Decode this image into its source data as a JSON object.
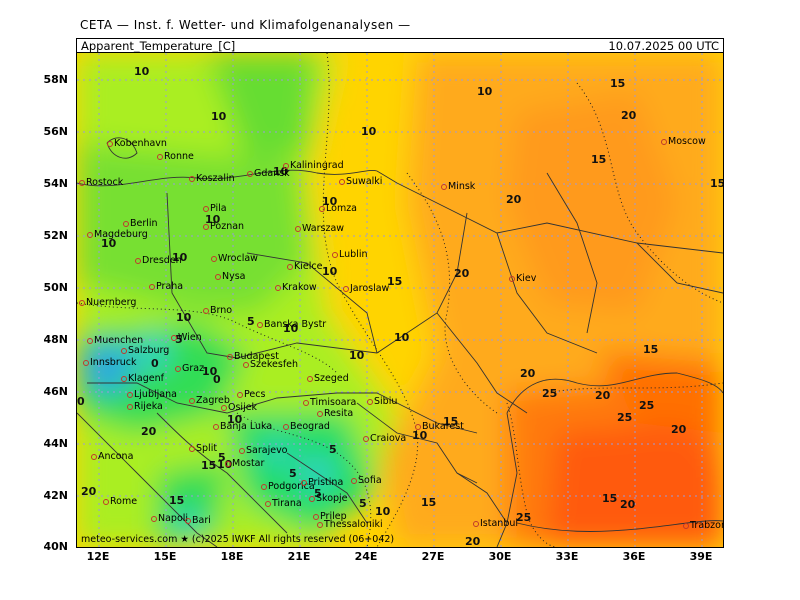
{
  "header": {
    "source": "CETA — Inst. f. Wetter- und Klimafolgenanalysen —",
    "parameter": "Apparent_Temperature_[C]",
    "valid_time": "10.07.2025 00 UTC"
  },
  "axes": {
    "lat_labels": [
      "58N",
      "56N",
      "54N",
      "52N",
      "50N",
      "48N",
      "46N",
      "44N",
      "42N",
      "40N"
    ],
    "lon_labels": [
      "12E",
      "15E",
      "18E",
      "21E",
      "24E",
      "27E",
      "30E",
      "33E",
      "36E",
      "39E"
    ]
  },
  "cities": [
    "Kobenhavn",
    "Ronne",
    "Rostock",
    "Koszalin",
    "Gdansk",
    "Kaliningrad",
    "Suwalki",
    "Minsk",
    "Moscow",
    "Pila",
    "Poznan",
    "Lomza",
    "Berlin",
    "Magdeburg",
    "Warszaw",
    "Lublin",
    "Dresden",
    "Wroclaw",
    "Kielce",
    "Nysa",
    "Praha",
    "Krakow",
    "Jaroslaw",
    "Kiev",
    "Nuernberg",
    "Brno",
    "Banska Bystr",
    "Muenchen",
    "Salzburg",
    "Wien",
    "Innsbruck",
    "Budapest",
    "Szekesfeh",
    "Graz",
    "Klagenf",
    "Szeged",
    "Ljubljana",
    "Rijeka",
    "Pecs",
    "Osijek",
    "Timisoara",
    "Sibiu",
    "Zagreb",
    "Resita",
    "Banja Luka",
    "Beograd",
    "Bukarest",
    "Craiova",
    "Ancona",
    "Split",
    "Sarajevo",
    "Mostar",
    "Podgorica",
    "Pristina",
    "Sofia",
    "Skopje",
    "Tirana",
    "Prilep",
    "Thessaloniki",
    "Rome",
    "Napoli",
    "Bari",
    "Istanbul",
    "Trabzon"
  ],
  "isolines": [
    "10",
    "10",
    "10",
    "10",
    "10",
    "10",
    "10",
    "10",
    "10",
    "10",
    "10",
    "10",
    "10",
    "10",
    "10",
    "10",
    "10",
    "10",
    "10",
    "15",
    "15",
    "15",
    "15",
    "15",
    "15",
    "15",
    "15",
    "15",
    "15",
    "20",
    "20",
    "20",
    "20",
    "20",
    "20",
    "20",
    "20",
    "20",
    "20",
    "25",
    "25",
    "25",
    "25",
    "5",
    "5",
    "5",
    "5",
    "5",
    "5",
    "5",
    "0",
    "0",
    "0"
  ],
  "footer": {
    "copyright": "meteo-services.com ★ (c)2025 IWKF All rights reserved (06+042)"
  },
  "colors": {
    "cold_blue": "#2fa8e0",
    "cyan": "#33d1c8",
    "green": "#22dd44",
    "lime": "#99ee22",
    "yellow": "#ffd400",
    "orange": "#ff9a1a",
    "red_orange": "#ff5a0a",
    "border": "#333333",
    "grid": "#9999dd",
    "city_marker": "#c0392b"
  }
}
